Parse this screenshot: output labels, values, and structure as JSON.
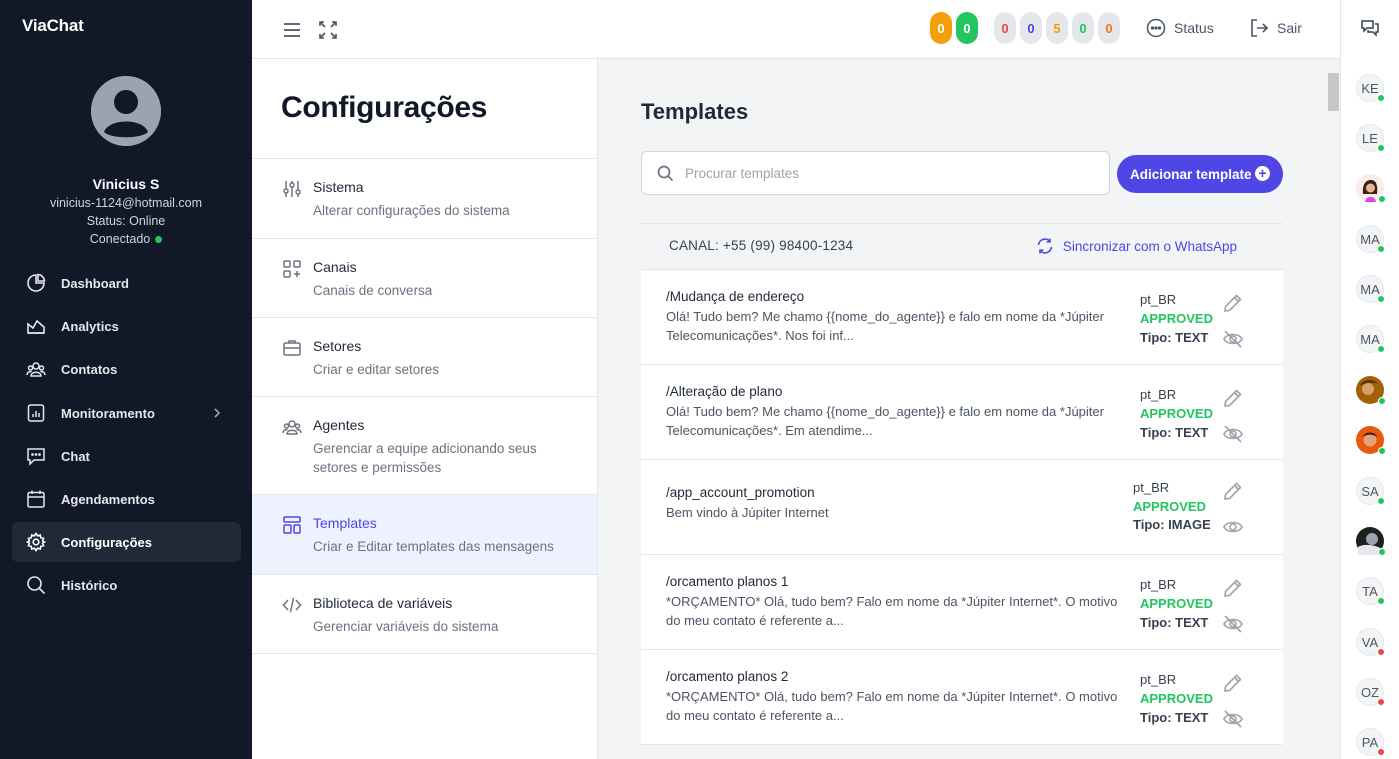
{
  "brand": "ViaChat",
  "user": {
    "name": "Vinicius S",
    "email": "vinicius-1124@hotmail.com",
    "status": "Status: Online",
    "connection": "Conectado"
  },
  "nav": [
    {
      "label": "Dashboard",
      "icon": "chart-pie-icon"
    },
    {
      "label": "Analytics",
      "icon": "analytics-icon"
    },
    {
      "label": "Contatos",
      "icon": "contacts-icon"
    },
    {
      "label": "Monitoramento",
      "icon": "monitor-chart-icon"
    },
    {
      "label": "Chat",
      "icon": "chat-bubble-icon"
    },
    {
      "label": "Agendamentos",
      "icon": "calendar-icon"
    },
    {
      "label": "Configurações",
      "icon": "gear-icon",
      "active": true
    },
    {
      "label": "Histórico",
      "icon": "search-icon"
    }
  ],
  "topbar": {
    "badges": [
      "0",
      "0",
      "0",
      "0",
      "5",
      "0",
      "0"
    ],
    "status_label": "Status",
    "logout_label": "Sair"
  },
  "config": {
    "title": "Configurações",
    "items": [
      {
        "label": "Sistema",
        "desc": "Alterar configurações do sistema"
      },
      {
        "label": "Canais",
        "desc": "Canais de conversa"
      },
      {
        "label": "Setores",
        "desc": "Criar e editar setores"
      },
      {
        "label": "Agentes",
        "desc": "Gerenciar a equipe adicionando seus setores e permissões"
      },
      {
        "label": "Templates",
        "desc": "Criar e Editar templates das mensagens",
        "active": true
      },
      {
        "label": "Biblioteca de variáveis",
        "desc": "Gerenciar variáveis do sistema"
      }
    ]
  },
  "templates": {
    "title": "Templates",
    "search_placeholder": "Procurar templates",
    "add_label": "Adicionar template",
    "canal": "CANAL: +55 (99) 98400-1234",
    "sync_label": "Sincronizar com o WhatsApp",
    "items": [
      {
        "name": "/Mudança de endereço",
        "body": "Olá! Tudo bem? Me chamo {{nome_do_agente}} e falo em nome da *Júpiter Telecomunicações*. Nos foi inf...",
        "lang": "pt_BR",
        "status": "APPROVED",
        "type": "Tipo: TEXT",
        "visible": false
      },
      {
        "name": "/Alteração de plano",
        "body": "Olá! Tudo bem? Me chamo {{nome_do_agente}} e falo em nome da *Júpiter Telecomunicações*. Em atendime...",
        "lang": "pt_BR",
        "status": "APPROVED",
        "type": "Tipo: TEXT",
        "visible": false
      },
      {
        "name": "/app_account_promotion",
        "body": "Bem vindo à Júpiter Internet",
        "lang": "pt_BR",
        "status": "APPROVED",
        "type": "Tipo: IMAGE",
        "visible": true
      },
      {
        "name": "/orcamento planos 1",
        "body": "*ORÇAMENTO* Olá, tudo bem? Falo em nome da *Júpiter Internet*. O motivo do meu contato é referente a...",
        "lang": "pt_BR",
        "status": "APPROVED",
        "type": "Tipo: TEXT",
        "visible": false
      },
      {
        "name": "/orcamento planos 2",
        "body": "*ORÇAMENTO* Olá, tudo bem? Falo em nome da *Júpiter Internet*. O motivo do meu contato é referente a...",
        "lang": "pt_BR",
        "status": "APPROVED",
        "type": "Tipo: TEXT",
        "visible": false
      }
    ]
  },
  "contacts": [
    {
      "initials": "KE",
      "status": "online"
    },
    {
      "initials": "LE",
      "status": "online"
    },
    {
      "initials": "",
      "status": "online",
      "photo": true
    },
    {
      "initials": "MA",
      "status": "online"
    },
    {
      "initials": "MA",
      "status": "online"
    },
    {
      "initials": "MA",
      "status": "online"
    },
    {
      "initials": "",
      "status": "online",
      "photo": true
    },
    {
      "initials": "",
      "status": "online",
      "photo": true
    },
    {
      "initials": "SA",
      "status": "online"
    },
    {
      "initials": "",
      "status": "online",
      "photo": true
    },
    {
      "initials": "TA",
      "status": "online"
    },
    {
      "initials": "VA",
      "status": "offline"
    },
    {
      "initials": "OZ",
      "status": "offline"
    },
    {
      "initials": "PA",
      "status": "offline"
    }
  ],
  "colors": {
    "sidebar_bg": "#111827",
    "accent": "#4f46e5",
    "approved": "#22c55e",
    "online": "#22c55e",
    "offline": "#ef4444"
  }
}
